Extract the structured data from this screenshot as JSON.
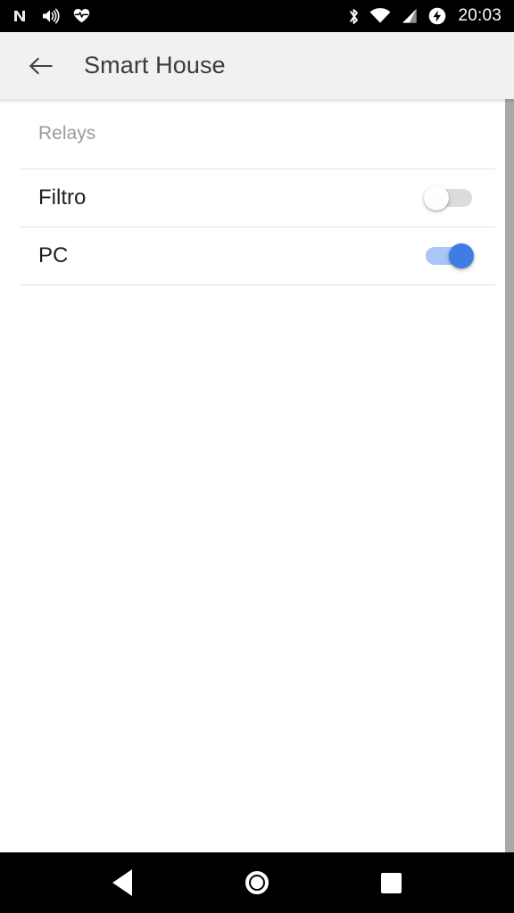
{
  "status_bar": {
    "left_icons": [
      "nougat-n-icon",
      "volume-icon",
      "heart-rate-icon"
    ],
    "right_icons": [
      "bluetooth-icon",
      "wifi-icon",
      "cellular-signal-icon",
      "battery-charging-icon"
    ],
    "time": "20:03",
    "background_color": "#000000"
  },
  "app_bar": {
    "back_icon": "back-arrow-icon",
    "title": "Smart House",
    "background_color": "#f1f1f1",
    "title_color": "#3b3b3b"
  },
  "content": {
    "sections": [
      {
        "header": "Relays",
        "header_color": "#9b9b9b",
        "rows": [
          {
            "label": "Filtro",
            "toggle_on": false,
            "toggle_state": "off"
          },
          {
            "label": "PC",
            "toggle_on": true,
            "toggle_state": "on"
          }
        ]
      }
    ],
    "divider_color": "#e4e4e4",
    "background_color": "#ffffff",
    "accent_color": "#3f7ce4",
    "toggle_off_track_color": "#dcdcdc",
    "toggle_on_track_color": "#a8c6f7"
  },
  "nav_bar": {
    "background_color": "#000000",
    "buttons": [
      {
        "name": "back-nav-button",
        "icon": "triangle-back-icon"
      },
      {
        "name": "home-nav-button",
        "icon": "circle-home-icon"
      },
      {
        "name": "recents-nav-button",
        "icon": "square-recents-icon"
      }
    ]
  }
}
